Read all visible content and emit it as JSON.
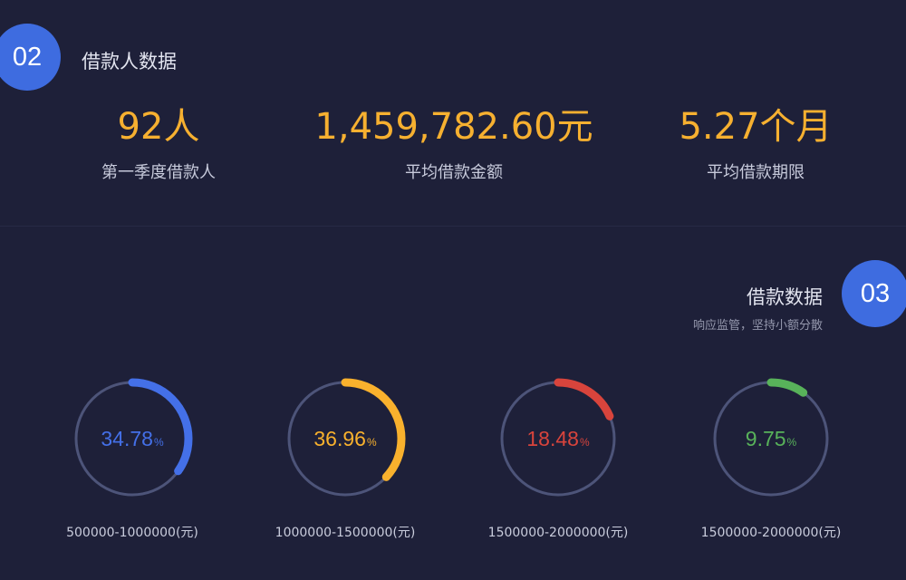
{
  "borrower_section": {
    "number": "02",
    "title": "借款人数据",
    "stats": [
      {
        "value": "92人",
        "label": "第一季度借款人"
      },
      {
        "value": "1,459,782.60元",
        "label": "平均借款金额"
      },
      {
        "value": "5.27个月",
        "label": "平均借款期限"
      }
    ]
  },
  "loan_section": {
    "number": "03",
    "title": "借款数据",
    "subtitle": "响应监管，坚持小额分散",
    "percent_sign": "%",
    "items": [
      {
        "value": 34.78,
        "value_text": "34.78",
        "range_label": "500000-1000000(元)",
        "color": "#4470e8"
      },
      {
        "value": 36.96,
        "value_text": "36.96",
        "range_label": "1000000-1500000(元)",
        "color": "#f9b12d"
      },
      {
        "value": 18.48,
        "value_text": "18.48",
        "range_label": "1500000-2000000(元)",
        "color": "#d8443c"
      },
      {
        "value": 9.75,
        "value_text": "9.75",
        "range_label": "1500000-2000000(元)",
        "color": "#58b25a"
      }
    ]
  },
  "colors": {
    "background": "#1e2039",
    "accent": "#3e6ce0",
    "stat_value": "#f6b030",
    "ring_track": "#4d5479"
  }
}
